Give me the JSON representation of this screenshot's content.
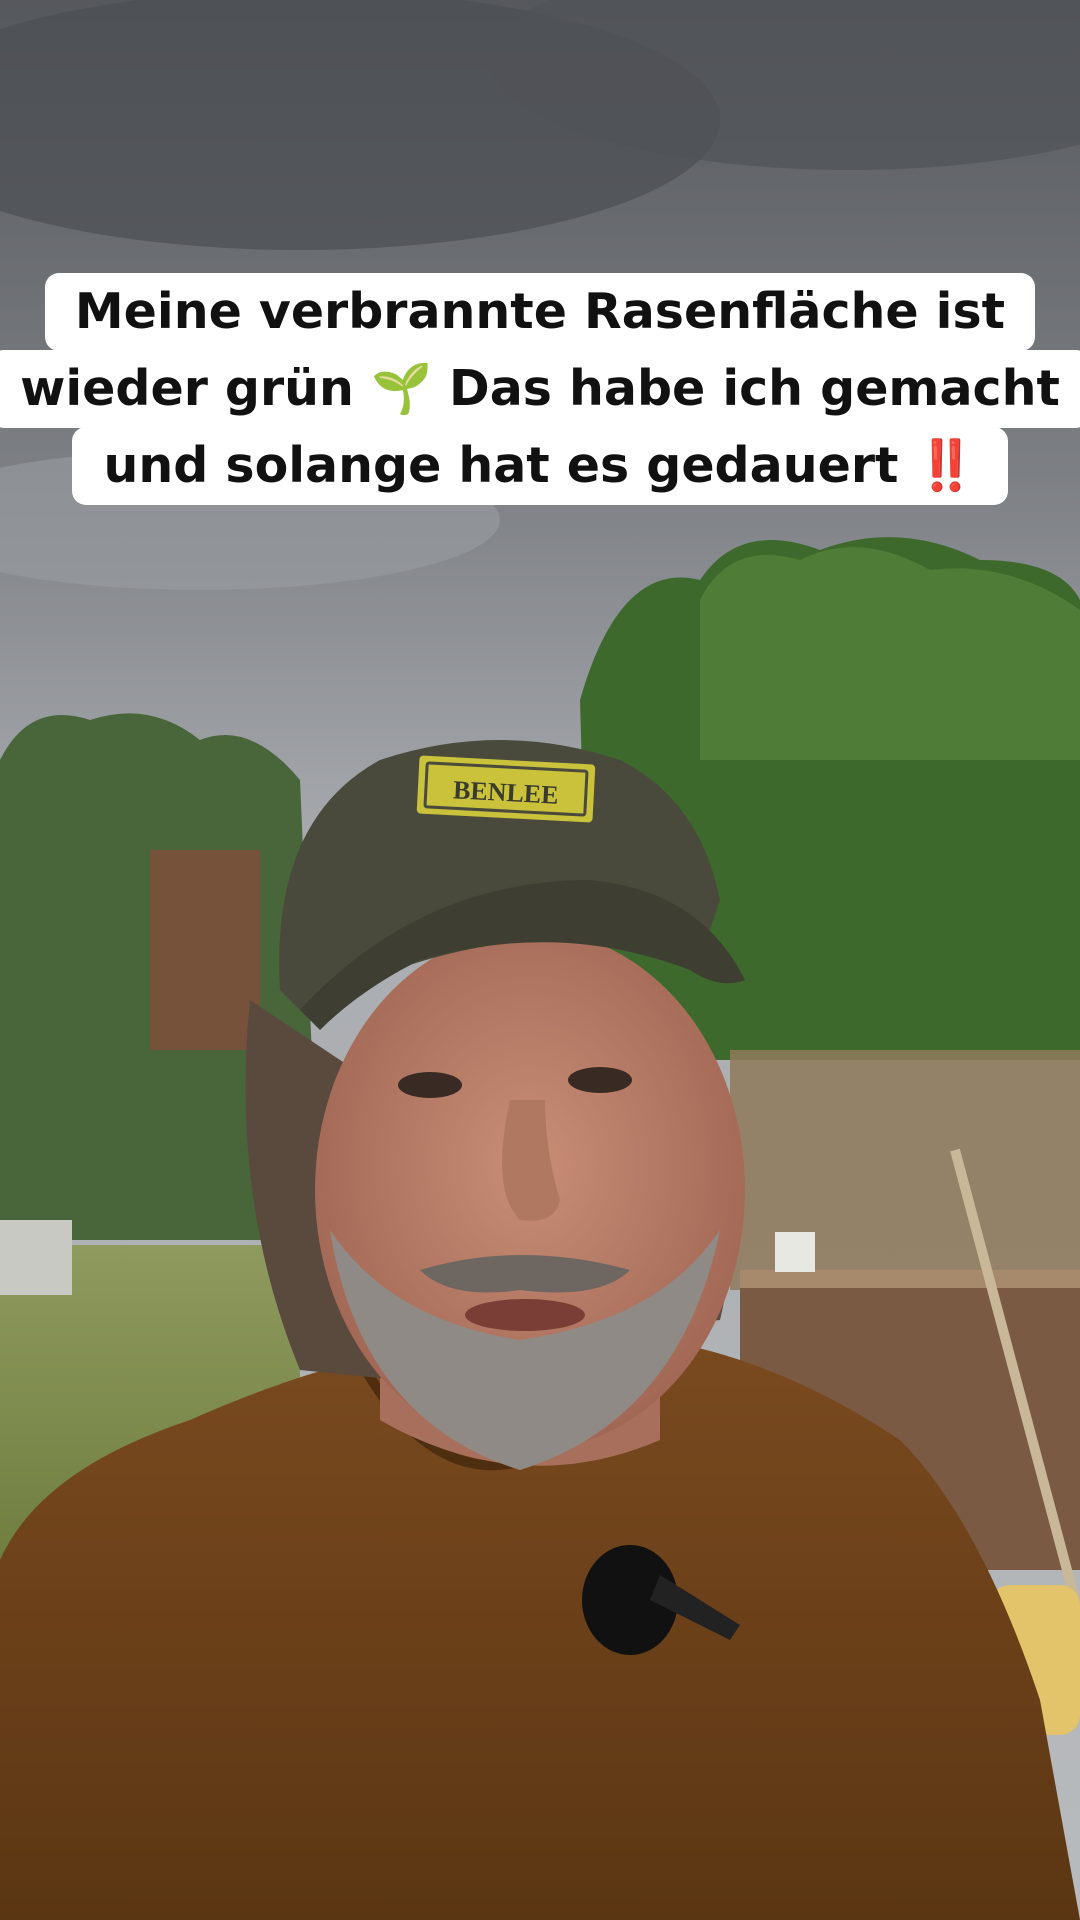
{
  "caption": {
    "lines": [
      "Meine verbrannte Rasenfläche ist",
      "wieder grün 🌱 Das habe ich gemacht",
      "und solange hat es gedauert ‼️"
    ]
  },
  "cap_logo_text": "BENLEE",
  "colors": {
    "sky": "#8f9296",
    "foliage": "#3f6b2e",
    "shirt": "#6b3f18",
    "cap": "#4a4a3c",
    "cap_badge": "#c9c23a",
    "caption_bg": "#ffffff",
    "caption_text": "#111111"
  }
}
